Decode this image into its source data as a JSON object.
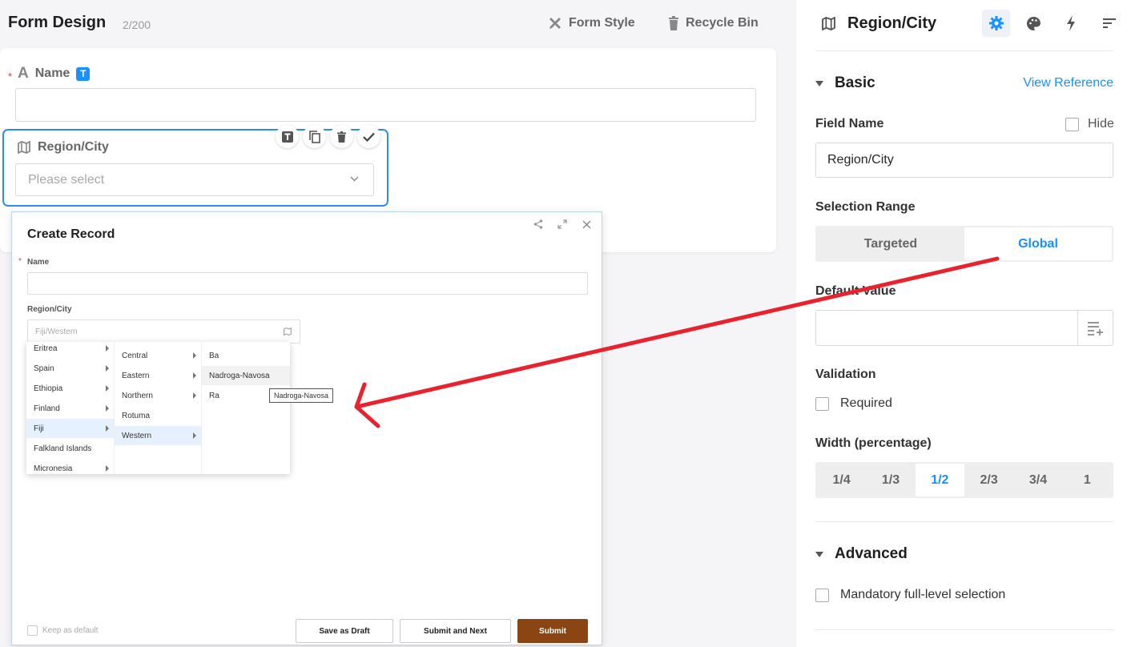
{
  "header": {
    "title": "Form Design",
    "count": "2/200",
    "form_style": "Form Style",
    "recycle_bin": "Recycle Bin"
  },
  "form": {
    "name_label": "Name",
    "name_type_badge": "T",
    "region_label": "Region/City",
    "region_placeholder": "Please select"
  },
  "record": {
    "title": "Create Record",
    "name_label": "Name",
    "region_label": "Region/City",
    "region_value": "Fiji/Western",
    "tooltip": "Nadroga-Navosa",
    "keep_default": "Keep as default",
    "save_draft": "Save as Draft",
    "submit_next": "Submit and Next",
    "submit": "Submit",
    "cascader": {
      "countries": [
        {
          "label": "Eritrea",
          "has_children": true
        },
        {
          "label": "Spain",
          "has_children": true
        },
        {
          "label": "Ethiopia",
          "has_children": true
        },
        {
          "label": "Finland",
          "has_children": true
        },
        {
          "label": "Fiji",
          "has_children": true,
          "active": true
        },
        {
          "label": "Falkland Islands",
          "has_children": false
        },
        {
          "label": "Micronesia",
          "has_children": true
        }
      ],
      "regions": [
        {
          "label": "Central",
          "has_children": true
        },
        {
          "label": "Eastern",
          "has_children": true
        },
        {
          "label": "Northern",
          "has_children": true
        },
        {
          "label": "Rotuma",
          "has_children": false
        },
        {
          "label": "Western",
          "has_children": true,
          "active": true
        }
      ],
      "districts": [
        {
          "label": "Ba",
          "has_children": false
        },
        {
          "label": "Nadroga-Navosa",
          "has_children": false,
          "hover": true
        },
        {
          "label": "Ra",
          "has_children": false
        }
      ]
    }
  },
  "panel": {
    "title": "Region/City",
    "basic": "Basic",
    "view_reference": "View Reference",
    "field_name_label": "Field Name",
    "hide": "Hide",
    "field_name_value": "Region/City",
    "selection_range_label": "Selection Range",
    "range_targeted": "Targeted",
    "range_global": "Global",
    "default_value_label": "Default Value",
    "validation_label": "Validation",
    "required": "Required",
    "width_label": "Width (percentage)",
    "widths": [
      "1/4",
      "1/3",
      "1/2",
      "2/3",
      "3/4",
      "1"
    ],
    "width_selected": "1/2",
    "advanced": "Advanced",
    "mandatory_full_level": "Mandatory full-level selection"
  },
  "colors": {
    "accent": "#1890ff",
    "submit": "#8b4513",
    "annotation_arrow": "#e8232e",
    "required_star": "#e23c3c"
  }
}
